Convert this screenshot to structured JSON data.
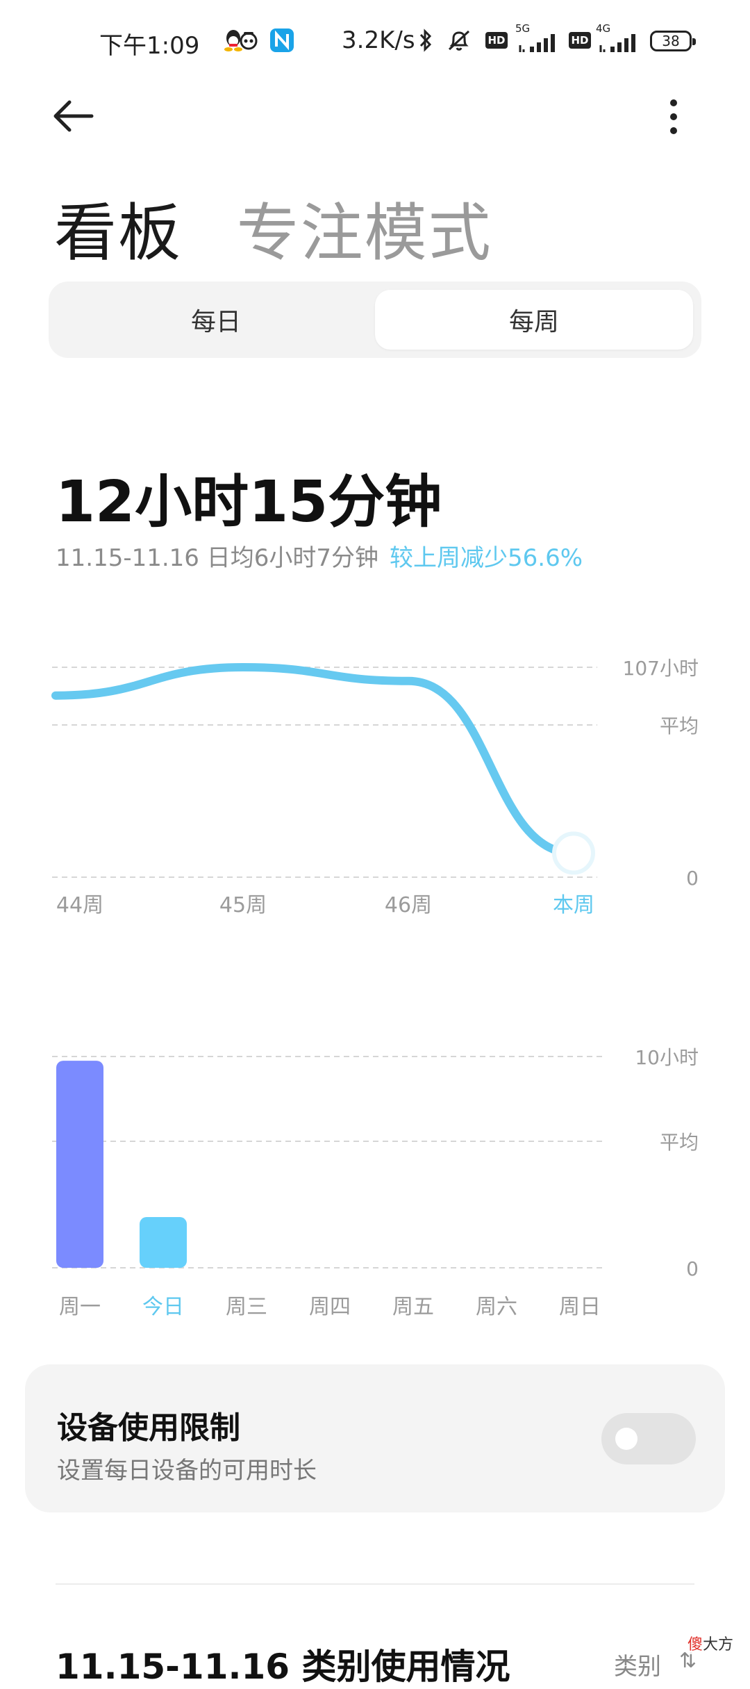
{
  "status": {
    "time": "下午1:09",
    "net_speed": "3.2K/s",
    "hd": "HD",
    "net1": "5G",
    "net2": "4G",
    "battery": "38"
  },
  "header": {
    "title_active": "看板",
    "title_inactive": "专注模式"
  },
  "segment": {
    "options": [
      "每日",
      "每周"
    ],
    "selected": "每周"
  },
  "summary": {
    "total": "12小时15分钟",
    "range_avg": "11.15-11.16 日均6小时7分钟",
    "compare": "较上周减少56.6%"
  },
  "weekly_chart": {
    "y_top_label": "107小时",
    "avg_label": "平均",
    "zero_label": "0",
    "x_labels": [
      "44周",
      "45周",
      "46周",
      "本周"
    ]
  },
  "daily_chart": {
    "y_top_label": "10小时",
    "avg_label": "平均",
    "zero_label": "0",
    "x_labels": [
      "周一",
      "今日",
      "周三",
      "周四",
      "周五",
      "周六",
      "周日"
    ]
  },
  "chart_data": [
    {
      "type": "line",
      "x": [
        "44周",
        "45周",
        "46周",
        "本周"
      ],
      "series": [
        {
          "values": [
            94,
            107,
            100,
            12.25
          ]
        }
      ],
      "ylim": [
        0,
        107
      ],
      "y_ticks": [
        "107小时",
        "平均",
        "0"
      ],
      "grid": true,
      "colors": {
        "line": "#66c9f0"
      }
    },
    {
      "type": "bar",
      "categories": [
        "周一",
        "今日",
        "周三",
        "周四",
        "周五",
        "周六",
        "周日"
      ],
      "values": [
        9.8,
        2.4,
        0,
        0,
        0,
        0,
        0
      ],
      "ylim": [
        0,
        10
      ],
      "y_ticks": [
        "10小时",
        "平均",
        "0"
      ],
      "grid": true,
      "colors": {
        "周一": "#7b8bff",
        "今日": "#66d0fb"
      }
    }
  ],
  "limit": {
    "title": "设备使用限制",
    "desc": "设置每日设备的可用时长",
    "enabled": false
  },
  "bottom": {
    "title": "11.15-11.16 类别使用情况",
    "filter": "类别",
    "watermark_red": "傻",
    "watermark_black": "大方"
  },
  "colors": {
    "accent": "#5ec8ef",
    "bar_monday": "#7b8bff",
    "bar_today": "#66d0fb"
  }
}
